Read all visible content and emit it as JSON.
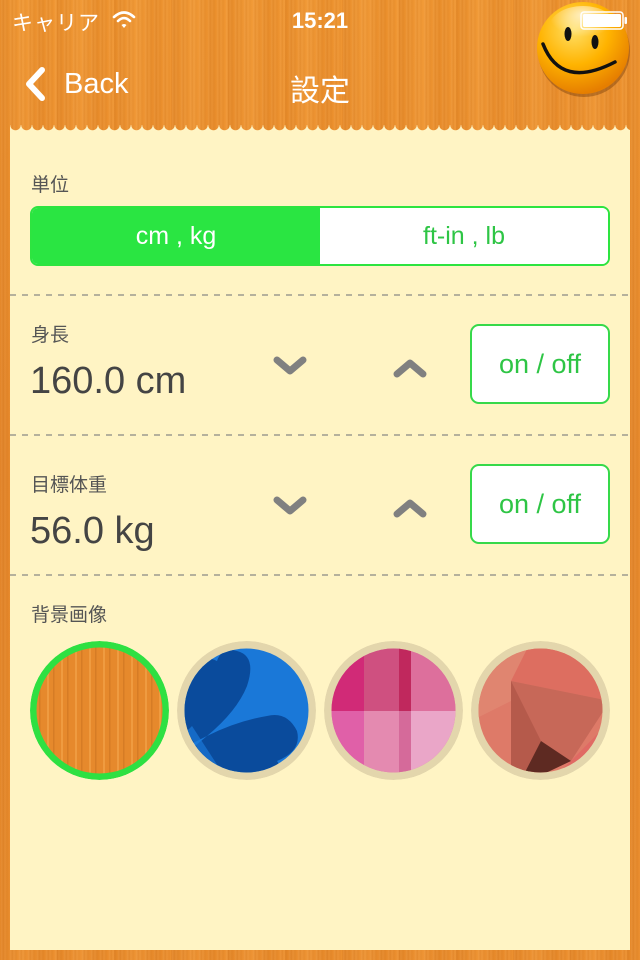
{
  "status_bar": {
    "carrier": "キャリア",
    "time": "15:21",
    "wifi_icon": "wifi-icon",
    "battery_icon": "battery-icon"
  },
  "nav": {
    "back_label": "Back",
    "title": "設定",
    "mascot_icon": "smiley-face-icon"
  },
  "units": {
    "label": "単位",
    "options": [
      "cm , kg",
      "ft-in , lb"
    ],
    "selected": "cm , kg"
  },
  "height": {
    "label": "身長",
    "value": "160.0 cm",
    "toggle_label": "on / off"
  },
  "target_weight": {
    "label": "目標体重",
    "value": "56.0 kg",
    "toggle_label": "on / off"
  },
  "background": {
    "label": "背景画像",
    "options": [
      {
        "name": "wood",
        "selected": true
      },
      {
        "name": "blue-clover",
        "selected": false
      },
      {
        "name": "pink-plaid",
        "selected": false
      },
      {
        "name": "coral-polygon",
        "selected": false
      }
    ]
  },
  "colors": {
    "accent_green": "#2ae542",
    "panel_bg": "#fff4c4",
    "wood_orange": "#e8892c",
    "chevron_gray": "#808080"
  }
}
